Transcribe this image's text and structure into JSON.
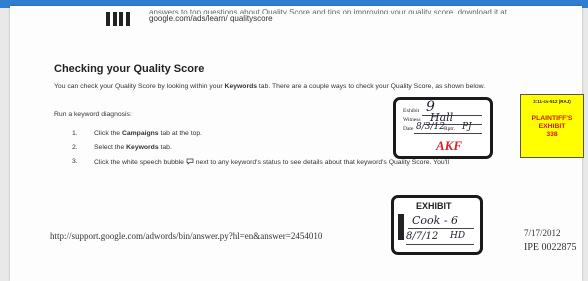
{
  "top": {
    "text_line1": "answers to top questions about Quality Score and tips on improving your quality score. download it at",
    "text_line2": "google.com/ads/learn/ qualityscore"
  },
  "heading": "Checking your Quality Score",
  "intro": {
    "part1": "You can check your Quality Score by looking within your ",
    "bold": "Keywords",
    "part2": " tab. There are a couple ways to check your Quality Score, as shown below."
  },
  "diagnosis_label": "Run a keyword diagnosis:",
  "steps": [
    {
      "num": "1.",
      "pre": "Click the ",
      "bold": "Campaigns",
      "post": " tab at the top."
    },
    {
      "num": "2.",
      "pre": "Select the ",
      "bold": "Keywords",
      "post": " tab."
    },
    {
      "num": "3.",
      "pre": "Click the white speech bubble ",
      "icon": "speech-bubble-icon",
      "post": " next to any keyword's status to see details about that keyword's Quality Score. You'll"
    }
  ],
  "footer": {
    "url": "http://support.google.com/adwords/bin/answer.py?hl=en&answer=2454010",
    "date": "7/17/2012",
    "bates": "IPE 0022875"
  },
  "sticker1": {
    "exhibit_label": "Exhibit",
    "exhibit_value": "9",
    "witness_label": "Witness",
    "witness_value": "Hall",
    "date_label": "Date",
    "date_value": "8/3/12",
    "reporter_label": "Rptr.",
    "reporter_value": "PJ",
    "logo": "AKF"
  },
  "yellow_sticker": {
    "case_no": "2:11-cv-512 (RAJ)",
    "line1": "PLAINTIFF'S",
    "line2": "EXHIBIT",
    "number": "338"
  },
  "sticker2": {
    "title": "EXHIBIT",
    "name": "Cook - 6",
    "date": "8/7/12",
    "initials": "HD"
  }
}
